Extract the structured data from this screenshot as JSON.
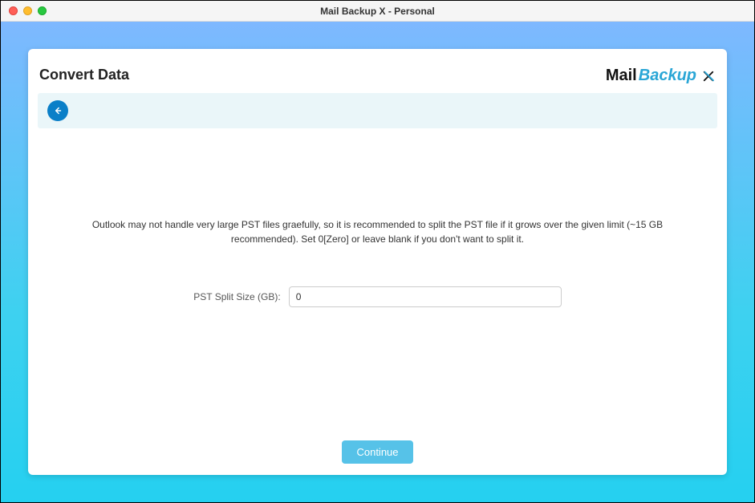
{
  "window": {
    "title": "Mail Backup X - Personal"
  },
  "page": {
    "title": "Convert Data"
  },
  "logo": {
    "mail": "Mail",
    "backup": "Backup"
  },
  "content": {
    "description": "Outlook may not handle very large PST files graefully, so it is recommended to split the PST file if it grows over the given limit (~15 GB recommended). Set 0[Zero] or leave blank if you don't want to split it.",
    "pst_label": "PST Split Size (GB):",
    "pst_value": "0"
  },
  "footer": {
    "continue_label": "Continue"
  }
}
